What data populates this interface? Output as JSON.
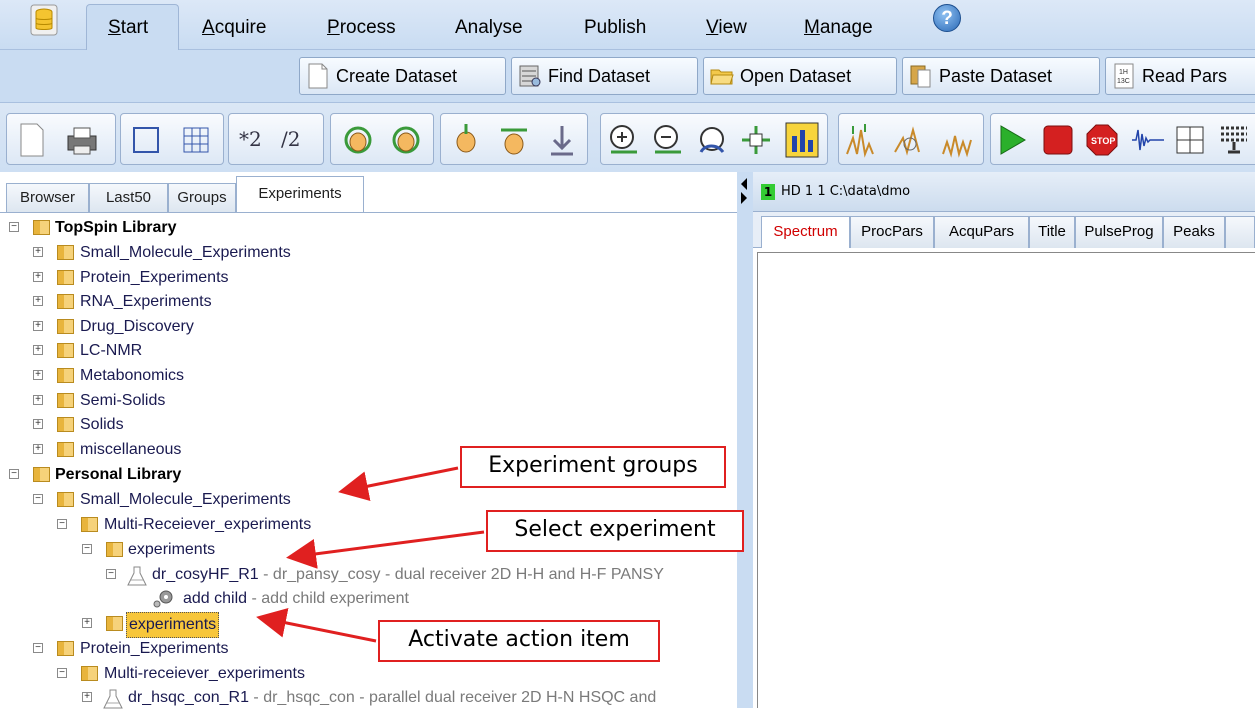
{
  "menu": {
    "items": [
      "Start",
      "Acquire",
      "Process",
      "Analyse",
      "Publish",
      "View",
      "Manage"
    ],
    "help_label": "?"
  },
  "ribbon": {
    "create": "Create Dataset",
    "find": "Find Dataset",
    "open": "Open Dataset",
    "paste": "Paste Dataset",
    "read": "Read Pars"
  },
  "toolbar": {
    "scale_up": "*2",
    "scale_down": "/2"
  },
  "browser": {
    "tabs": [
      "Browser",
      "Last50",
      "Groups",
      "Experiments"
    ],
    "active_tab": "Experiments",
    "tree": {
      "topspin_library": "TopSpin Library",
      "topspin_children": [
        "Small_Molecule_Experiments",
        "Protein_Experiments",
        "RNA_Experiments",
        "Drug_Discovery",
        "LC-NMR",
        "Metabonomics",
        "Semi-Solids",
        "Solids",
        "miscellaneous"
      ],
      "personal_library": "Personal Library",
      "small_molecule": "Small_Molecule_Experiments",
      "multi_receiver": "Multi-Receiever_experiments",
      "experiments": "experiments",
      "cosy_name": "dr_cosyHF_R1",
      "cosy_desc": " - dr_pansy_cosy - dual receiver 2D H-H and H-F PANSY",
      "add_child": "add child",
      "add_child_desc": " - add child experiment",
      "experiments_selected": "experiments",
      "protein": "Protein_Experiments",
      "protein_multi": "Multi-receiever_experiments",
      "hsqc_name": "dr_hsqc_con_R1",
      "hsqc_desc": " - dr_hsqc_con - parallel dual receiver 2D H-N HSQC and"
    }
  },
  "dataset": {
    "number": "1",
    "title": "HD 1 1 C:\\data\\dmo",
    "tabs": [
      "Spectrum",
      "ProcPars",
      "AcquPars",
      "Title",
      "PulseProg",
      "Peaks"
    ],
    "active_tab": "Spectrum"
  },
  "annotations": {
    "groups": "Experiment groups",
    "select": "Select experiment",
    "activate": "Activate action item",
    "color": "#e02020"
  }
}
